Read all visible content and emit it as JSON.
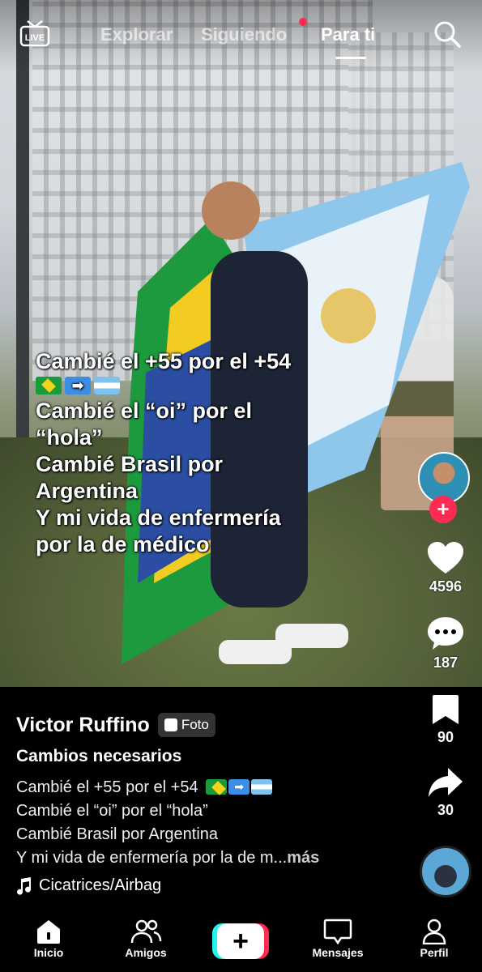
{
  "top_bar": {
    "live_label": "LIVE",
    "tabs": [
      {
        "label": "Explorar"
      },
      {
        "label": "Siguiendo"
      },
      {
        "label": "Para ti"
      }
    ]
  },
  "overlay_text": {
    "line1": "Cambié el +55 por el +54",
    "line2": "Cambié el “oi” por el",
    "line3": "“hola”",
    "line4": "Cambié Brasil por",
    "line5": "Argentina",
    "line6": "Y mi vida de enfermería",
    "line7": "por la de médico",
    "arrow": "➡"
  },
  "actions": {
    "likes": "4596",
    "comments": "187",
    "saves": "90",
    "shares": "30",
    "follow_symbol": "+"
  },
  "post": {
    "author": "Victor Ruffino",
    "badge": "Foto",
    "title": "Cambios necesarios",
    "desc_line1": "Cambié el +55 por el +54",
    "desc_line2": "Cambié el “oi” por el “hola”",
    "desc_line3": "Cambié Brasil por Argentina",
    "desc_line4": "Y mi vida de enfermería por la de m...",
    "more": "más",
    "sound": "Cicatrices/Airbag"
  },
  "bottom_nav": {
    "home": "Inicio",
    "friends": "Amigos",
    "create": "+",
    "inbox": "Mensajes",
    "profile": "Perfil"
  },
  "colors": {
    "accent_pink": "#fe2c55",
    "accent_cyan": "#25f4ee",
    "background": "#000000"
  }
}
